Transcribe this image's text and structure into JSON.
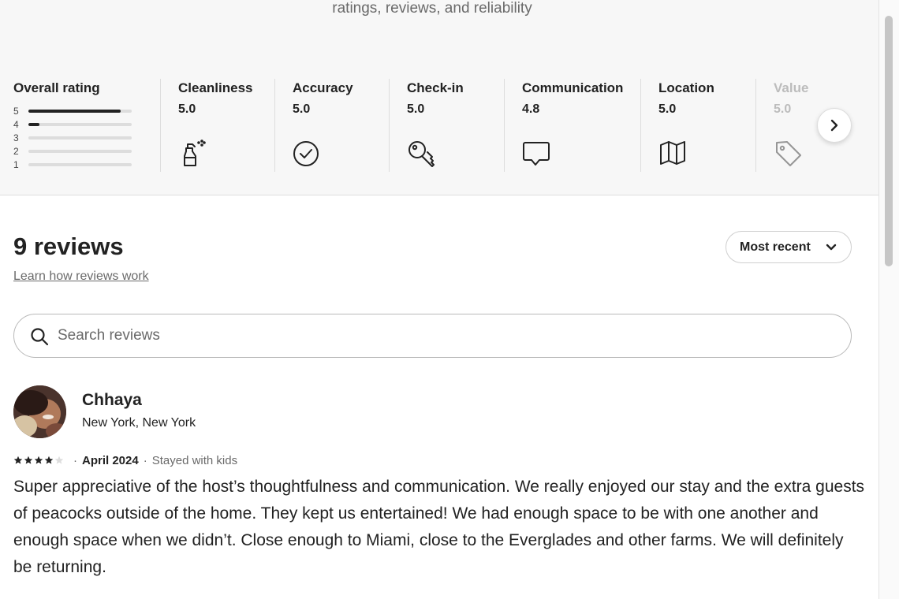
{
  "header": {
    "subtitle": "ratings, reviews, and reliability"
  },
  "overall": {
    "label": "Overall rating",
    "distribution": [
      {
        "stars": "5",
        "fraction": 0.89
      },
      {
        "stars": "4",
        "fraction": 0.11
      },
      {
        "stars": "3",
        "fraction": 0
      },
      {
        "stars": "2",
        "fraction": 0
      },
      {
        "stars": "1",
        "fraction": 0
      }
    ]
  },
  "categories": [
    {
      "label": "Cleanliness",
      "value": "5.0",
      "icon": "spray-bottle-icon"
    },
    {
      "label": "Accuracy",
      "value": "5.0",
      "icon": "check-circle-icon"
    },
    {
      "label": "Check-in",
      "value": "5.0",
      "icon": "key-icon"
    },
    {
      "label": "Communication",
      "value": "4.8",
      "icon": "chat-bubble-icon"
    },
    {
      "label": "Location",
      "value": "5.0",
      "icon": "map-icon"
    },
    {
      "label": "Value",
      "value": "5.0",
      "icon": "tag-icon"
    }
  ],
  "reviews_section": {
    "count_label": "9 reviews",
    "learn_link": "Learn how reviews work",
    "sort_label": "Most recent",
    "search_placeholder": "Search reviews"
  },
  "review": {
    "name": "Chhaya",
    "location": "New York, New York",
    "rating": 4,
    "date": "April 2024",
    "stay_type": "Stayed with kids",
    "text": "Super appreciative of the host’s thoughtfulness and communication. We really enjoyed our stay and the extra guests of peacocks outside of the home. They kept us entertained! We had enough space to be with one another and enough space when we didn’t. Close enough to Miami, close to the Everglades and other farms. We will definitely be returning."
  },
  "colors": {
    "text": "#222222",
    "muted": "#6a6a6a",
    "divider": "#dddddd",
    "band": "#f7f7f7"
  }
}
